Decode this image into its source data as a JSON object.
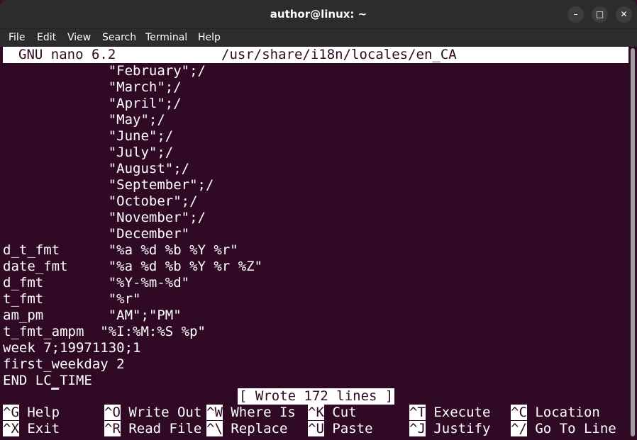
{
  "window": {
    "title": "author@linux: ~",
    "controls": {
      "minimize": "–",
      "maximize": "□",
      "close": "✕"
    }
  },
  "menu": [
    "File",
    "Edit",
    "View",
    "Search",
    "Terminal",
    "Help"
  ],
  "nano": {
    "version": "GNU nano 6.2",
    "filename": "/usr/share/i18n/locales/en_CA",
    "lines": [
      "             \"February\";/",
      "             \"March\";/",
      "             \"April\";/",
      "             \"May\";/",
      "             \"June\";/",
      "             \"July\";/",
      "             \"August\";/",
      "             \"September\";/",
      "             \"October\";/",
      "             \"November\";/",
      "             \"December\"",
      "d_t_fmt      \"%a %d %b %Y %r\"",
      "date_fmt     \"%a %d %b %Y %r %Z\"",
      "d_fmt        \"%Y-%m-%d\"",
      "t_fmt        \"%r\"",
      "am_pm        \"AM\";\"PM\"",
      "t_fmt_ampm  \"%I:%M:%S %p\"",
      "week 7;19971130;1",
      "first_weekday 2",
      "END LC_TIME"
    ],
    "status_message": "[ Wrote 172 lines ]",
    "shortcuts_row1": [
      {
        "key": "^G",
        "label": "Help"
      },
      {
        "key": "^O",
        "label": "Write Out"
      },
      {
        "key": "^W",
        "label": "Where Is"
      },
      {
        "key": "^K",
        "label": "Cut"
      },
      {
        "key": "^T",
        "label": "Execute"
      },
      {
        "key": "^C",
        "label": "Location"
      }
    ],
    "shortcuts_row2": [
      {
        "key": "^X",
        "label": "Exit"
      },
      {
        "key": "^R",
        "label": "Read File"
      },
      {
        "key": "^\\",
        "label": "Replace"
      },
      {
        "key": "^U",
        "label": "Paste"
      },
      {
        "key": "^J",
        "label": "Justify"
      },
      {
        "key": "^/",
        "label": "Go To Line"
      }
    ]
  },
  "colors": {
    "terminal_bg": "#300a24",
    "titlebar_bg": "#2c2c2c",
    "text": "#ffffff"
  }
}
